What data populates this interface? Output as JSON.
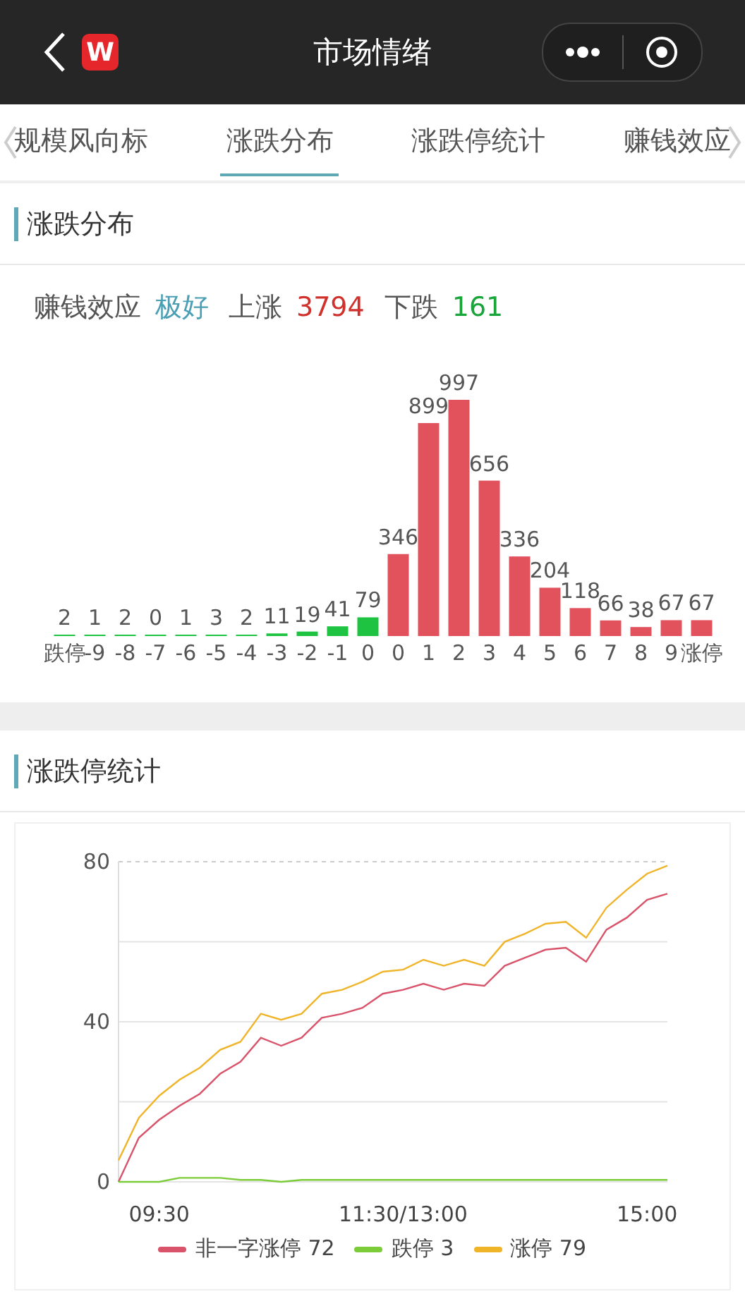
{
  "header": {
    "logo": "W",
    "title": "市场情绪"
  },
  "tabs": [
    {
      "label": "规模风向标",
      "selected": false
    },
    {
      "label": "涨跌分布",
      "selected": true
    },
    {
      "label": "涨跌停统计",
      "selected": false
    },
    {
      "label": "赚钱效应",
      "selected": false
    }
  ],
  "distribution": {
    "title": "涨跌分布",
    "summary": [
      {
        "label": "赚钱效应",
        "value": "极好",
        "color": "#4a9fb5"
      },
      {
        "label": "上涨",
        "value": "3794",
        "color": "#d0312d"
      },
      {
        "label": "下跌",
        "value": "161",
        "color": "#1aa53a"
      }
    ],
    "chart_data": {
      "type": "bar",
      "categories": [
        "跌停",
        "-9",
        "-8",
        "-7",
        "-6",
        "-5",
        "-4",
        "-3",
        "-2",
        "-1",
        "0",
        "0",
        "1",
        "2",
        "3",
        "4",
        "5",
        "6",
        "7",
        "8",
        "9",
        "涨停"
      ],
      "ylim": [
        0,
        1000
      ],
      "data_labels": true,
      "stacked": true,
      "series": [
        {
          "color": "#1ec441",
          "values": [
            2,
            1,
            2,
            0,
            1,
            3,
            2,
            11,
            19,
            41,
            79,
            null,
            null,
            null,
            null,
            null,
            null,
            null,
            null,
            null,
            null,
            null
          ]
        },
        {
          "color": "#e2525c",
          "values": [
            null,
            null,
            null,
            null,
            null,
            null,
            null,
            null,
            null,
            null,
            null,
            346,
            899,
            997,
            656,
            336,
            204,
            118,
            66,
            38,
            67,
            67
          ]
        }
      ]
    }
  },
  "limit_stats": {
    "title": "涨跌停统计",
    "chart_data": {
      "type": "line",
      "categories": [
        null,
        null,
        "09:30",
        null,
        null,
        null,
        null,
        null,
        null,
        null,
        null,
        null,
        null,
        null,
        "11:30/13:00",
        null,
        null,
        null,
        null,
        null,
        null,
        null,
        null,
        null,
        null,
        null,
        "15:00",
        null
      ],
      "ylim": [
        0,
        80
      ],
      "yticks": [
        0,
        40,
        80
      ],
      "series": [
        {
          "name": "非一字涨停 72",
          "color": "#d9536a",
          "values": [
            0,
            11,
            15.5,
            19,
            22,
            27,
            30,
            36,
            34,
            36,
            41,
            42,
            43.5,
            47,
            48,
            49.5,
            48,
            49.5,
            49,
            54,
            56,
            58,
            58.5,
            55,
            63,
            66,
            70.5,
            72
          ]
        },
        {
          "name": "跌停 3",
          "color": "#7ccc3a",
          "values": [
            0,
            0,
            0,
            1,
            1,
            1,
            0.5,
            0.5,
            0,
            0.5,
            0.5,
            0.5,
            0.5,
            0.5,
            0.5,
            0.5,
            0.5,
            0.5,
            0.5,
            0.5,
            0.5,
            0.5,
            0.5,
            0.5,
            0.5,
            0.5,
            0.5,
            0.5
          ]
        },
        {
          "name": "涨停 79",
          "color": "#f0b429",
          "values": [
            5.4,
            16,
            21.5,
            25.5,
            28.5,
            33,
            35,
            42,
            40.5,
            42,
            47,
            48,
            50,
            52.5,
            53,
            55.5,
            54,
            55.5,
            54,
            60,
            62,
            64.5,
            65,
            61,
            68.5,
            73,
            77,
            79
          ]
        }
      ]
    }
  }
}
